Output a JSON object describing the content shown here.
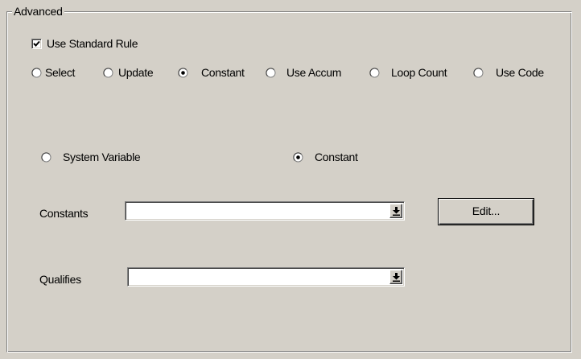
{
  "group": {
    "title": "Advanced"
  },
  "use_standard_rule": {
    "label": "Use Standard Rule",
    "checked": true
  },
  "rule_types": [
    {
      "label": "Select",
      "selected": false
    },
    {
      "label": "Update",
      "selected": false
    },
    {
      "label": "Constant",
      "selected": true
    },
    {
      "label": "Use Accum",
      "selected": false
    },
    {
      "label": "Loop Count",
      "selected": false
    },
    {
      "label": "Use Code",
      "selected": false
    }
  ],
  "source": {
    "system_variable": {
      "label": "System Variable",
      "selected": false
    },
    "constant": {
      "label": "Constant",
      "selected": true
    }
  },
  "constants": {
    "label": "Constants",
    "value": "",
    "edit_label": "Edit..."
  },
  "qualifies": {
    "label": "Qualifies",
    "value": ""
  }
}
